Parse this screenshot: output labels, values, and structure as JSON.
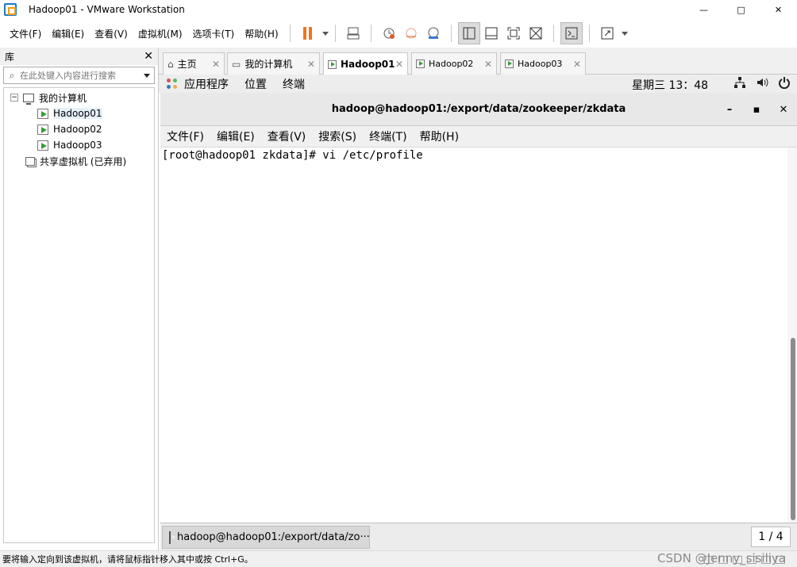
{
  "window": {
    "title": "Hadoop01 - VMware Workstation",
    "controls": {
      "minimize": "—",
      "maximize": "□",
      "close": "✕"
    }
  },
  "menu": [
    "文件(F)",
    "编辑(E)",
    "查看(V)",
    "虚拟机(M)",
    "选项卡(T)",
    "帮助(H)"
  ],
  "library": {
    "title": "库",
    "close": "✕",
    "search_placeholder": "在此处键入内容进行搜索",
    "tree": {
      "root_toggle": "−",
      "root_label": "我的计算机",
      "vms": [
        "Hadoop01",
        "Hadoop02",
        "Hadoop03"
      ],
      "shared_label": "共享虚拟机 (已弃用)"
    }
  },
  "tabs": [
    {
      "label": "主页",
      "icon": "home-icon"
    },
    {
      "label": "我的计算机",
      "icon": "monitor-icon"
    },
    {
      "label": "Hadoop01",
      "icon": "vm-icon",
      "active": true
    },
    {
      "label": "Hadoop02",
      "icon": "vm-icon"
    },
    {
      "label": "Hadoop03",
      "icon": "vm-icon"
    }
  ],
  "tab_close": "✕",
  "guest_topbar": {
    "apps": "应用程序",
    "places": "位置",
    "terminal": "终端",
    "clock": "星期三 13：48"
  },
  "terminal": {
    "title": "hadoop@hadoop01:/export/data/zookeeper/zkdata",
    "controls": {
      "minimize": "–",
      "maximize": "▪",
      "close": "✕"
    },
    "menu": [
      "文件(F)",
      "编辑(E)",
      "查看(V)",
      "搜索(S)",
      "终端(T)",
      "帮助(H)"
    ],
    "line": "[root@hadoop01 zkdata]# vi /etc/profile"
  },
  "guest_taskbar": {
    "task": "hadoop@hadoop01:/export/data/zo···",
    "workspace": "1 / 4"
  },
  "statusbar": {
    "message": "要将输入定向到该虚拟机，请将鼠标指针移入其中或按 Ctrl+G。",
    "watermark": "CSDN @Jenny_sisiliya"
  },
  "colors": {
    "pause": "#f0741e",
    "vm_play": "#3a9a3a",
    "accent": "#1e78c8"
  }
}
